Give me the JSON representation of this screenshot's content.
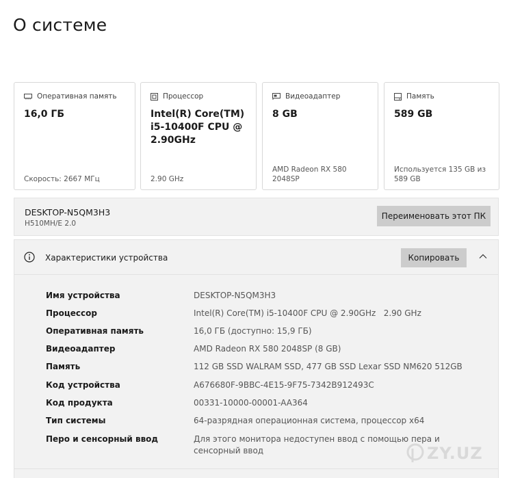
{
  "page": {
    "title": "О системе"
  },
  "cards": [
    {
      "icon": "memory-icon",
      "label": "Оперативная память",
      "value": "16,0 ГБ",
      "detail": "Скорость: 2667 МГц"
    },
    {
      "icon": "processor-icon",
      "label": "Процессор",
      "value": "Intel(R) Core(TM) i5-10400F CPU @ 2.90GHz",
      "detail": "2.90 GHz"
    },
    {
      "icon": "graphics-card-icon",
      "label": "Видеоадаптер",
      "value": "8 GB",
      "detail": "AMD Radeon RX 580 2048SP"
    },
    {
      "icon": "storage-icon",
      "label": "Память",
      "value": "589 GB",
      "detail": "Используется 135 GB из 589 GB"
    }
  ],
  "device": {
    "name": "DESKTOP-N5QM3H3",
    "model": "H510MH/E 2.0",
    "rename_label": "Переименовать этот ПК"
  },
  "specs": {
    "title": "Характеристики устройства",
    "copy_label": "Копировать",
    "rows": [
      {
        "label": "Имя устройства",
        "value": "DESKTOP-N5QM3H3"
      },
      {
        "label": "Процессор",
        "value": "Intel(R) Core(TM) i5-10400F CPU @ 2.90GHz   2.90 GHz"
      },
      {
        "label": "Оперативная память",
        "value": "16,0 ГБ (доступно: 15,9 ГБ)"
      },
      {
        "label": "Видеоадаптер",
        "value": "AMD Radeon RX 580 2048SP (8 GB)"
      },
      {
        "label": "Память",
        "value": "112 GB SSD WALRAM SSD, 477 GB SSD Lexar SSD NM620 512GB"
      },
      {
        "label": "Код устройства",
        "value": "A676680F-9BBC-4E15-9F75-7342B912493C"
      },
      {
        "label": "Код продукта",
        "value": "00331-10000-00001-AA364"
      },
      {
        "label": "Тип системы",
        "value": "64-разрядная операционная система, процессор x64"
      },
      {
        "label": "Перо и сенсорный ввод",
        "value": "Для этого монитора недоступен ввод с помощью пера и сенсорный ввод"
      }
    ]
  },
  "watermark": {
    "text": "ZY.UZ"
  }
}
